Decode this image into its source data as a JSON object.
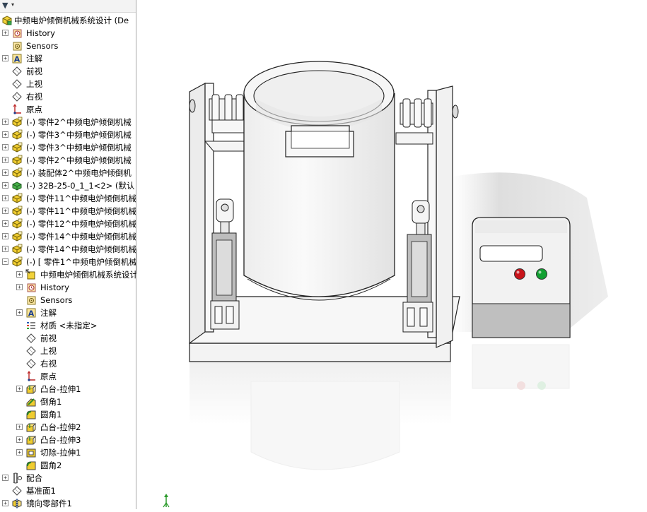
{
  "feature_tree": {
    "root": {
      "label": "中频电炉倾倒机械系统设计  (De",
      "icon": "assembly-icon"
    },
    "rows": [
      {
        "label": "History",
        "icon": "history-icon",
        "expander": "+",
        "indent": 0
      },
      {
        "label": "Sensors",
        "icon": "sensors-icon",
        "expander": "",
        "indent": 0
      },
      {
        "label": "注解",
        "icon": "annotations-icon",
        "expander": "+",
        "indent": 0
      },
      {
        "label": "前视",
        "icon": "plane-icon",
        "expander": "",
        "indent": 0
      },
      {
        "label": "上视",
        "icon": "plane-icon",
        "expander": "",
        "indent": 0
      },
      {
        "label": "右视",
        "icon": "plane-icon",
        "expander": "",
        "indent": 0
      },
      {
        "label": "原点",
        "icon": "origin-icon",
        "expander": "",
        "indent": 0
      },
      {
        "label": "(-) 零件2^中频电炉倾倒机械",
        "icon": "part-icon",
        "expander": "+",
        "indent": 0
      },
      {
        "label": "(-) 零件3^中频电炉倾倒机械",
        "icon": "part-icon",
        "expander": "+",
        "indent": 0
      },
      {
        "label": "(-) 零件3^中频电炉倾倒机械",
        "icon": "part-icon",
        "expander": "+",
        "indent": 0
      },
      {
        "label": "(-) 零件2^中频电炉倾倒机械",
        "icon": "part-icon",
        "expander": "+",
        "indent": 0
      },
      {
        "label": "(-) 装配体2^中频电炉倾倒机",
        "icon": "part-icon",
        "expander": "+",
        "indent": 0
      },
      {
        "label": "(-) 32B-25-0_1_1<2> (默认",
        "icon": "subassembly-icon",
        "expander": "+",
        "indent": 0
      },
      {
        "label": "(-) 零件11^中频电炉倾倒机械",
        "icon": "part-icon",
        "expander": "+",
        "indent": 0
      },
      {
        "label": "(-) 零件11^中频电炉倾倒机械",
        "icon": "part-icon",
        "expander": "+",
        "indent": 0
      },
      {
        "label": "(-) 零件12^中频电炉倾倒机械",
        "icon": "part-icon",
        "expander": "+",
        "indent": 0
      },
      {
        "label": "(-) 零件14^中频电炉倾倒机械",
        "icon": "part-icon",
        "expander": "+",
        "indent": 0
      },
      {
        "label": "(-) 零件14^中频电炉倾倒机械",
        "icon": "part-icon",
        "expander": "+",
        "indent": 0
      },
      {
        "label": "(-) [ 零件1^中频电炉倾倒机械",
        "icon": "part-icon",
        "expander": "−",
        "indent": 0
      },
      {
        "label": "中频电炉倾倒机械系统设计",
        "icon": "reference-icon",
        "expander": "+",
        "indent": 1
      },
      {
        "label": "History",
        "icon": "history-icon",
        "expander": "+",
        "indent": 1
      },
      {
        "label": "Sensors",
        "icon": "sensors-icon",
        "expander": "",
        "indent": 1
      },
      {
        "label": "注解",
        "icon": "annotations-icon",
        "expander": "+",
        "indent": 1
      },
      {
        "label": "材质 <未指定>",
        "icon": "material-icon",
        "expander": "",
        "indent": 1
      },
      {
        "label": "前视",
        "icon": "plane-icon",
        "expander": "",
        "indent": 1
      },
      {
        "label": "上视",
        "icon": "plane-icon",
        "expander": "",
        "indent": 1
      },
      {
        "label": "右视",
        "icon": "plane-icon",
        "expander": "",
        "indent": 1
      },
      {
        "label": "原点",
        "icon": "origin-icon",
        "expander": "",
        "indent": 1
      },
      {
        "label": "凸台-拉伸1",
        "icon": "extrude-icon",
        "expander": "+",
        "indent": 1
      },
      {
        "label": "倒角1",
        "icon": "chamfer-icon",
        "expander": "",
        "indent": 1
      },
      {
        "label": "圆角1",
        "icon": "fillet-icon",
        "expander": "",
        "indent": 1
      },
      {
        "label": "凸台-拉伸2",
        "icon": "extrude-icon",
        "expander": "+",
        "indent": 1
      },
      {
        "label": "凸台-拉伸3",
        "icon": "extrude-icon",
        "expander": "+",
        "indent": 1
      },
      {
        "label": "切除-拉伸1",
        "icon": "cut-extrude-icon",
        "expander": "+",
        "indent": 1
      },
      {
        "label": "圆角2",
        "icon": "fillet-icon",
        "expander": "",
        "indent": 1
      },
      {
        "label": "配合",
        "icon": "mates-icon",
        "expander": "+",
        "indent": 0
      },
      {
        "label": "基准面1",
        "icon": "plane-icon",
        "expander": "",
        "indent": 0
      },
      {
        "label": "镜向零部件1",
        "icon": "mirror-component-icon",
        "expander": "+",
        "indent": 0
      }
    ]
  },
  "viewport": {
    "control_box_lights": [
      {
        "color": "#c8141b",
        "name": "red-indicator-light"
      },
      {
        "color": "#12a032",
        "name": "green-indicator-light"
      }
    ]
  },
  "colors": {
    "tree_text": "#000000",
    "panel_border": "#a8a8a8",
    "model_outline": "#222222",
    "model_face": "#f4f4f4",
    "model_shadow": "#d8d8d8",
    "control_box_body": "#f2f2f2"
  }
}
